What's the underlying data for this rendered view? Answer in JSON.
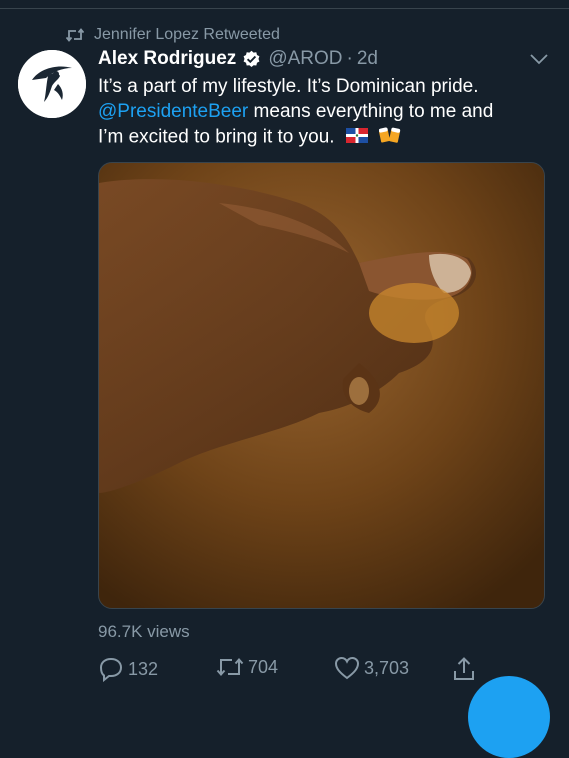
{
  "retweet_context": {
    "text": "Jennifer Lopez Retweeted",
    "icon": "retweet-icon"
  },
  "tweet": {
    "display_name": "Alex Rodriguez",
    "handle": "@AROD",
    "separator": "·",
    "time": "2d",
    "verified": true,
    "text_line1": "It’s a part of my lifestyle. It’s Dominican pride.",
    "mention": "@PresidenteBeer",
    "text_line2_rest": " means everything to me and",
    "text_line3": "I’m excited to bring it to you.",
    "emojis": [
      "dominican-republic-flag-emoji",
      "clinking-beer-mugs-emoji"
    ]
  },
  "media": {
    "type": "video",
    "description_icon": "video-thumbnail"
  },
  "stats": {
    "views": "96.7K views",
    "replies": "132",
    "retweets": "704",
    "likes": "3,703"
  },
  "colors": {
    "background": "#15202b",
    "accent": "#1da1f2",
    "secondary_text": "#8899a6",
    "divider": "#38444d"
  }
}
